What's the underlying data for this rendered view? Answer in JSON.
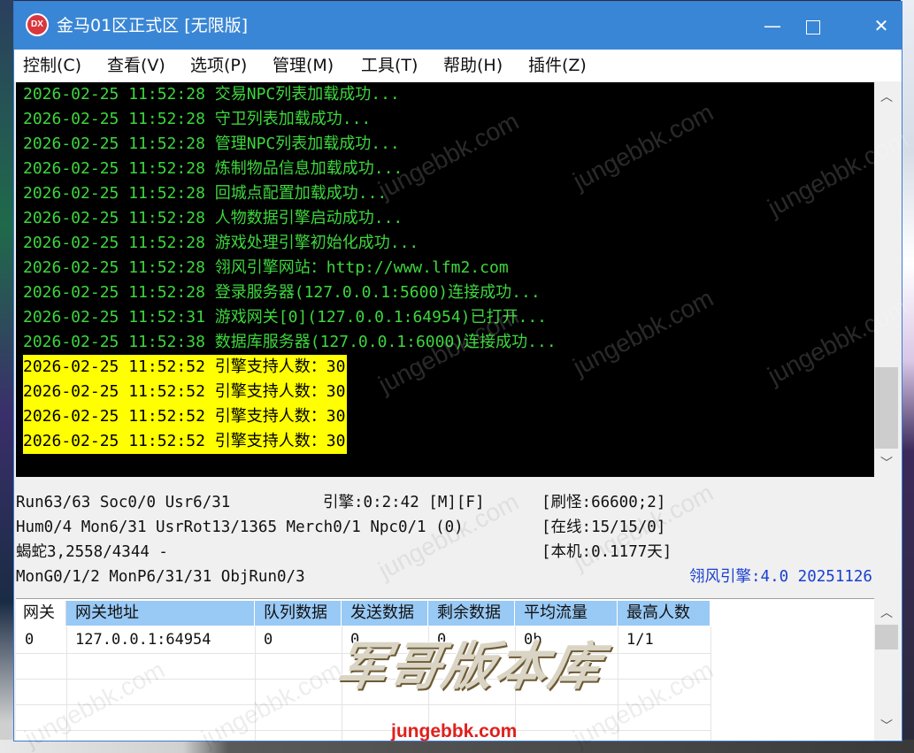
{
  "window": {
    "title": "金马01区正式区 [无限版]",
    "icon_text": "DX",
    "minimize_glyph": "—",
    "close_glyph": "✕"
  },
  "menu": [
    "控制(C)",
    "查看(V)",
    "选项(P)",
    "管理(M)",
    "工具(T)",
    "帮助(H)",
    "插件(Z)"
  ],
  "log": [
    {
      "time": "2026-02-25 11:52:28",
      "msg": "交易NPC列表加载成功...",
      "highlight": false
    },
    {
      "time": "2026-02-25 11:52:28",
      "msg": "守卫列表加载成功...",
      "highlight": false
    },
    {
      "time": "2026-02-25 11:52:28",
      "msg": "管理NPC列表加载成功...",
      "highlight": false
    },
    {
      "time": "2026-02-25 11:52:28",
      "msg": "炼制物品信息加载成功...",
      "highlight": false
    },
    {
      "time": "2026-02-25 11:52:28",
      "msg": "回城点配置加载成功...",
      "highlight": false
    },
    {
      "time": "2026-02-25 11:52:28",
      "msg": "人物数据引擎启动成功...",
      "highlight": false
    },
    {
      "time": "2026-02-25 11:52:28",
      "msg": "游戏处理引擎初始化成功...",
      "highlight": false
    },
    {
      "time": "2026-02-25 11:52:28",
      "msg": "翎风引擎网站：http://www.lfm2.com",
      "highlight": false
    },
    {
      "time": "2026-02-25 11:52:28",
      "msg": "登录服务器(127.0.0.1:5600)连接成功...",
      "highlight": false
    },
    {
      "time": "2026-02-25 11:52:31",
      "msg": "游戏网关[0](127.0.0.1:64954)已打开...",
      "highlight": false
    },
    {
      "time": "2026-02-25 11:52:38",
      "msg": "数据库服务器(127.0.0.1:6000)连接成功...",
      "highlight": false
    },
    {
      "time": "2026-02-25 11:52:52",
      "msg": "引擎支持人数：30",
      "highlight": true
    },
    {
      "time": "2026-02-25 11:52:52",
      "msg": "引擎支持人数：30",
      "highlight": true
    },
    {
      "time": "2026-02-25 11:52:52",
      "msg": "引擎支持人数：30",
      "highlight": true
    },
    {
      "time": "2026-02-25 11:52:52",
      "msg": "引擎支持人数：30",
      "highlight": true
    }
  ],
  "status": {
    "run": "Run63/63 Soc0/0 Usr6/31",
    "engine_time": "引擎:0:2:42 [M][F]",
    "refresh": "[刷怪:66600;2]",
    "hum": "Hum0/4 Mon6/31 UsrRot13/1365 Merch0/1 Npc0/1 (0)",
    "online": "[在线:15/15/0]",
    "monster": "蝎蛇3,2558/4344 -",
    "local": "[本机:0.1177天]",
    "mon_line": "MonG0/1/2 MonP6/31/31 ObjRun0/3",
    "version": "翎风引擎:4.0 20251126"
  },
  "gateway_table": {
    "columns": [
      "网关",
      "网关地址",
      "队列数据",
      "发送数据",
      "剩余数据",
      "平均流量",
      "最高人数"
    ],
    "rows": [
      [
        "0",
        "127.0.0.1:64954",
        "0",
        "0",
        "0",
        "0b",
        "1/1"
      ]
    ]
  },
  "watermark": {
    "text": "jungebbk.com",
    "logo": "军哥版本库",
    "url": "jungebbk.com"
  },
  "colors": {
    "titlebar": "#3a86d6",
    "log_text": "#3ed63e",
    "highlight": "#ffff00",
    "header": "#99c9f5",
    "version_text": "#1a3fcf"
  }
}
